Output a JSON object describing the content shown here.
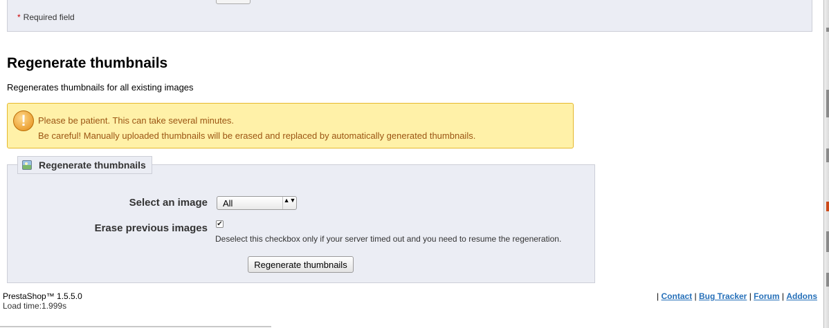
{
  "top_panel": {
    "required_mark": "*",
    "required_text": "Required field"
  },
  "section": {
    "title": "Regenerate thumbnails",
    "description": "Regenerates thumbnails for all existing images"
  },
  "warning": {
    "icon": "warning-icon",
    "line1": "Please be patient. This can take several minutes.",
    "line2": "Be careful! Manually uploaded thumbnails will be erased and replaced by automatically generated thumbnails."
  },
  "form": {
    "legend": "Regenerate thumbnails",
    "legend_icon": "image-icon",
    "select_label": "Select an image",
    "select_value": "All",
    "select_arrows": "▲▼",
    "erase_label": "Erase previous images",
    "erase_checked": true,
    "erase_check_glyph": "✔",
    "erase_hint": "Deselect this checkbox only if your server timed out and you need to resume the regeneration.",
    "submit_label": "Regenerate thumbnails"
  },
  "footer": {
    "version": "PrestaShop™ 1.5.5.0",
    "load_time": "Load time:1.999s",
    "separator": "|",
    "links": [
      "Contact",
      "Bug Tracker",
      "Forum",
      "Addons"
    ]
  },
  "colors": {
    "panel_bg": "#ebedf4",
    "warning_bg": "#fff1a8",
    "warning_text": "#9b5513",
    "link": "#2670b9",
    "required_star": "#cc0000"
  }
}
